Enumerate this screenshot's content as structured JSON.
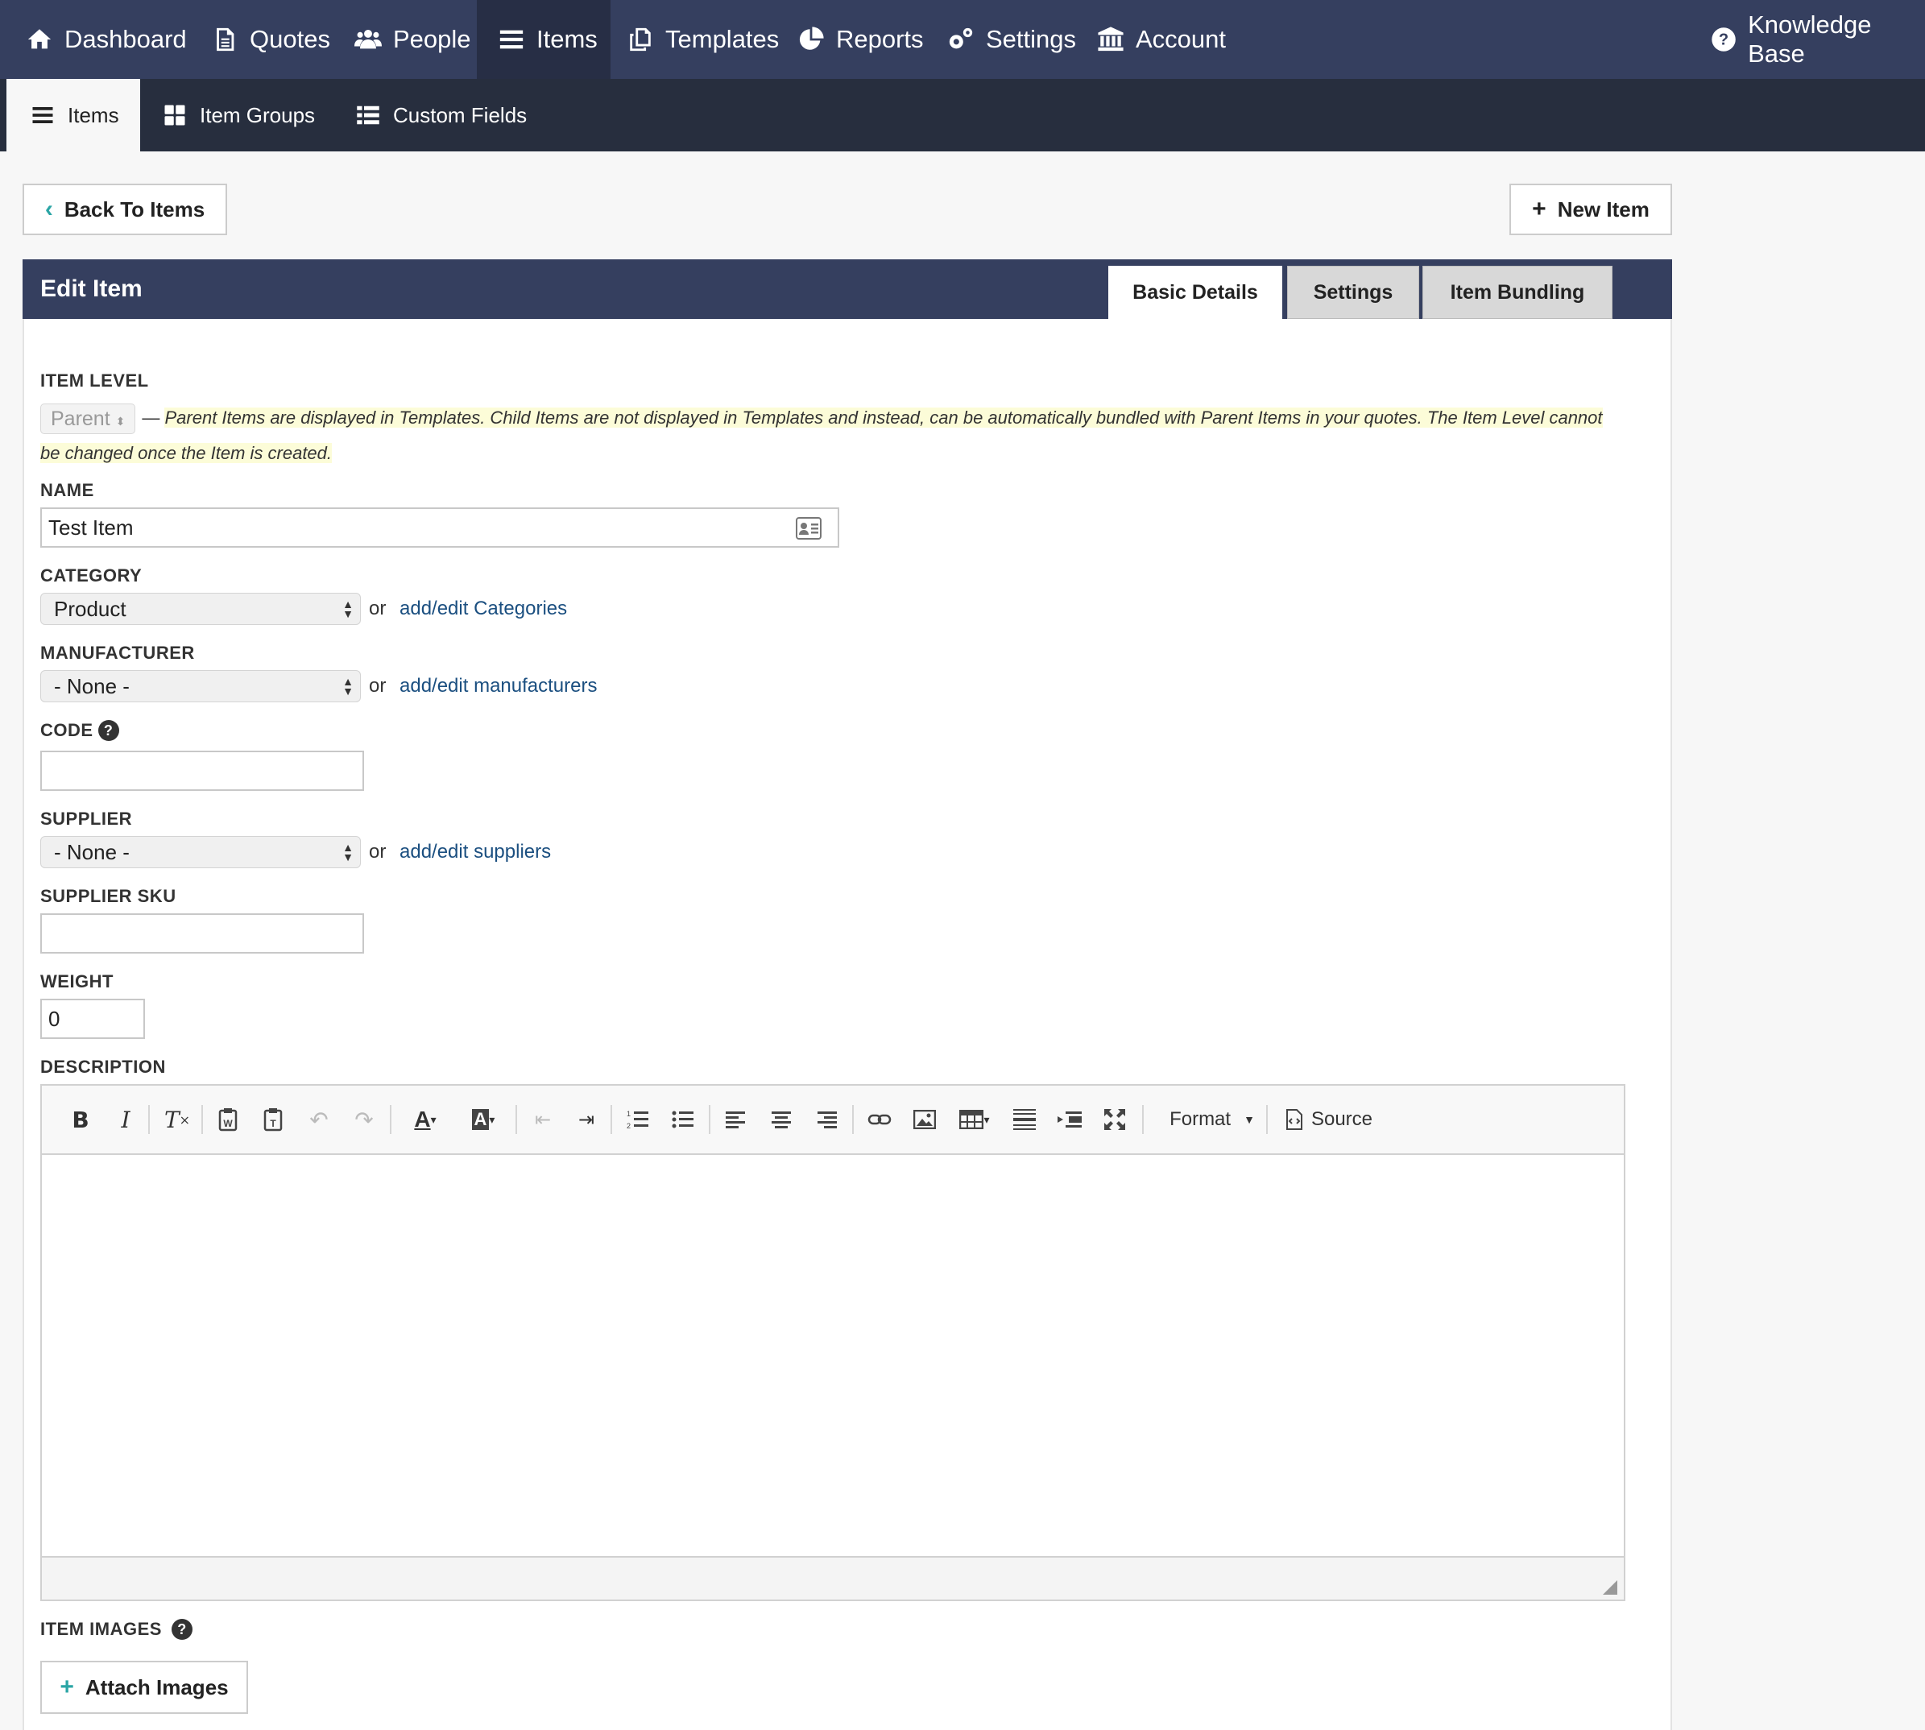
{
  "topnav": {
    "dashboard": "Dashboard",
    "quotes": "Quotes",
    "people": "People",
    "items": "Items",
    "templates": "Templates",
    "reports": "Reports",
    "settings": "Settings",
    "account": "Account",
    "knowledge_base": "Knowledge Base"
  },
  "subnav": {
    "items": "Items",
    "item_groups": "Item Groups",
    "custom_fields": "Custom Fields"
  },
  "actions": {
    "back": "Back To Items",
    "new_item": "New Item"
  },
  "panel": {
    "title": "Edit Item",
    "tabs": [
      "Basic Details",
      "Settings",
      "Item Bundling"
    ]
  },
  "form": {
    "item_level_label": "ITEM LEVEL",
    "item_level_value": "Parent",
    "item_level_hint": "Parent Items are displayed in Templates. Child Items are not displayed in Templates and instead, can be automatically bundled with Parent Items in your quotes. The Item Level cannot be changed once the Item is created.",
    "name_label": "NAME",
    "name_value": "Test Item",
    "category_label": "CATEGORY",
    "category_value": "Product",
    "category_link": "add/edit Categories",
    "manufacturer_label": "MANUFACTURER",
    "manufacturer_value": "- None -",
    "manufacturer_link": "add/edit manufacturers",
    "code_label": "CODE",
    "code_value": "",
    "supplier_label": "SUPPLIER",
    "supplier_value": "- None -",
    "supplier_link": "add/edit suppliers",
    "supplier_sku_label": "SUPPLIER SKU",
    "supplier_sku_value": "",
    "weight_label": "WEIGHT",
    "weight_value": "0",
    "description_label": "DESCRIPTION",
    "item_images_label": "ITEM IMAGES",
    "attach_images": "Attach Images",
    "or": "or"
  },
  "editor": {
    "format_label": "Format",
    "source_label": "Source"
  }
}
